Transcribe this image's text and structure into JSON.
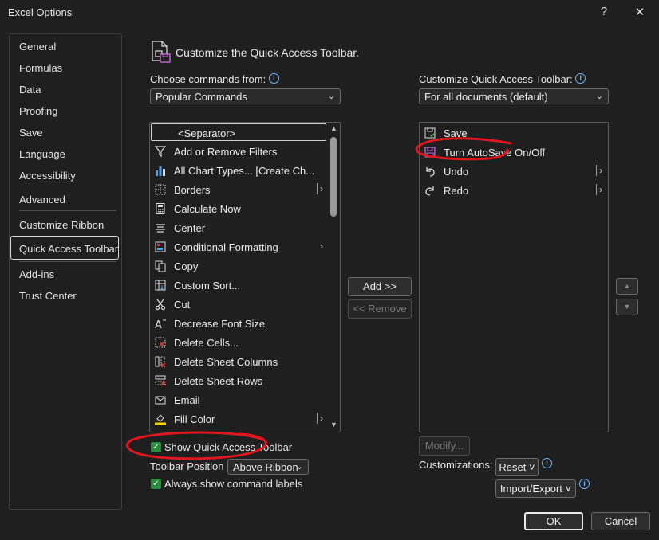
{
  "window": {
    "title": "Excel Options",
    "help_glyph": "?",
    "close_glyph": "✕"
  },
  "nav": {
    "items": [
      {
        "label": "General"
      },
      {
        "label": "Formulas"
      },
      {
        "label": "Data"
      },
      {
        "label": "Proofing"
      },
      {
        "label": "Save"
      },
      {
        "label": "Language"
      },
      {
        "label": "Accessibility"
      },
      {
        "label": "Advanced"
      },
      {
        "label": "Customize Ribbon"
      },
      {
        "label": "Quick Access Toolbar"
      },
      {
        "label": "Add-ins"
      },
      {
        "label": "Trust Center"
      }
    ],
    "selected": "Quick Access Toolbar"
  },
  "header": {
    "title": "Customize the Quick Access Toolbar."
  },
  "left": {
    "choose_label": "Choose commands from:",
    "choose_value": "Popular Commands",
    "commands": [
      {
        "label": "<Separator>",
        "icon": "separator"
      },
      {
        "label": "Add or Remove Filters",
        "icon": "filter-icon"
      },
      {
        "label": "All Chart Types... [Create Ch...",
        "icon": "chart-icon"
      },
      {
        "label": "Borders",
        "icon": "borders-icon",
        "submenu": "split"
      },
      {
        "label": "Calculate Now",
        "icon": "calculator-icon"
      },
      {
        "label": "Center",
        "icon": "center-align-icon"
      },
      {
        "label": "Conditional Formatting",
        "icon": "conditional-format-icon",
        "submenu": "arrow"
      },
      {
        "label": "Copy",
        "icon": "copy-icon"
      },
      {
        "label": "Custom Sort...",
        "icon": "sort-icon"
      },
      {
        "label": "Cut",
        "icon": "scissors-icon"
      },
      {
        "label": "Decrease Font Size",
        "icon": "decrease-font-icon"
      },
      {
        "label": "Delete Cells...",
        "icon": "delete-cells-icon"
      },
      {
        "label": "Delete Sheet Columns",
        "icon": "delete-columns-icon"
      },
      {
        "label": "Delete Sheet Rows",
        "icon": "delete-rows-icon"
      },
      {
        "label": "Email",
        "icon": "email-icon"
      },
      {
        "label": "Fill Color",
        "icon": "fill-color-icon",
        "submenu": "split"
      }
    ],
    "show_qat_label": "Show Quick Access Toolbar",
    "toolbar_position_label": "Toolbar Position",
    "toolbar_position_value": "Above Ribbon",
    "always_show_labels": "Always show command labels"
  },
  "middle": {
    "add_label": "Add >>",
    "remove_label": "<< Remove"
  },
  "right": {
    "customize_label": "Customize Quick Access Toolbar:",
    "customize_value": "For all documents (default)",
    "items": [
      {
        "label": "Save",
        "icon": "save-icon"
      },
      {
        "label": "Turn AutoSave On/Off",
        "icon": "autosave-icon"
      },
      {
        "label": "Undo",
        "icon": "undo-icon",
        "submenu": "split"
      },
      {
        "label": "Redo",
        "icon": "redo-icon",
        "submenu": "split"
      }
    ],
    "modify_label": "Modify...",
    "customizations_label": "Customizations:",
    "reset_label": "Reset ˅",
    "import_export_label": "Import/Export ˅"
  },
  "footer": {
    "ok_label": "OK",
    "cancel_label": "Cancel"
  },
  "colors": {
    "background": "#1f1f1f",
    "annotation": "#e0161e",
    "check": "#2a8a3e",
    "info": "#6fb7ff"
  }
}
